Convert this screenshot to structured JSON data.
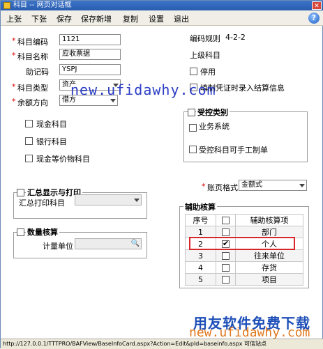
{
  "window": {
    "title": "科目 -- 网页对话框"
  },
  "menu": [
    "上张",
    "下张",
    "保存",
    "保存新增",
    "复制",
    "设置",
    "退出"
  ],
  "form": {
    "code_label": "科目编码",
    "code_value": "1121",
    "name_label": "科目名称",
    "name_value": "应收票据",
    "mnemonic_label": "助记码",
    "mnemonic_value": "YSPJ",
    "type_label": "科目类型",
    "type_value": "资产",
    "direction_label": "余额方向",
    "direction_value": "借方",
    "coding_rule_label": "编码规则",
    "coding_rule_value": "4-2-2",
    "parent_label": "上级科目",
    "disable_label": "停用",
    "voucher_label": "填制凭证时录入结算信息",
    "cash_label": "现金科目",
    "bank_label": "银行科目",
    "cash_equiv_label": "现金等价物科目"
  },
  "controlled": {
    "title": "受控类别",
    "business_label": "业务系统",
    "manual_label": "受控科目可手工制单"
  },
  "summary": {
    "title": "汇总显示与打印",
    "print_label": "汇总打印科目"
  },
  "quantity": {
    "title": "数量核算",
    "unit_label": "计量单位"
  },
  "ledger": {
    "label": "账页格式",
    "value": "金额式"
  },
  "aux": {
    "title": "辅助核算",
    "headers": [
      "序号",
      "",
      "辅助核算项"
    ],
    "rows": [
      {
        "no": "1",
        "checked": false,
        "item": "部门"
      },
      {
        "no": "2",
        "checked": true,
        "item": "个人"
      },
      {
        "no": "3",
        "checked": false,
        "item": "往来单位"
      },
      {
        "no": "4",
        "checked": false,
        "item": "存货"
      },
      {
        "no": "5",
        "checked": false,
        "item": "项目"
      }
    ]
  },
  "watermarks": {
    "top": "new.ufidawhy.com",
    "bottom_cn": "用友软件免费下载",
    "bottom_url": "new.ufidawhy.com"
  },
  "statusbar": {
    "text": "http://127.0.0.1/TTTPRO/BAFView/BaseInfoCard.aspx?Action=Edit&pId=baseinfo.aspx 可信站点"
  }
}
